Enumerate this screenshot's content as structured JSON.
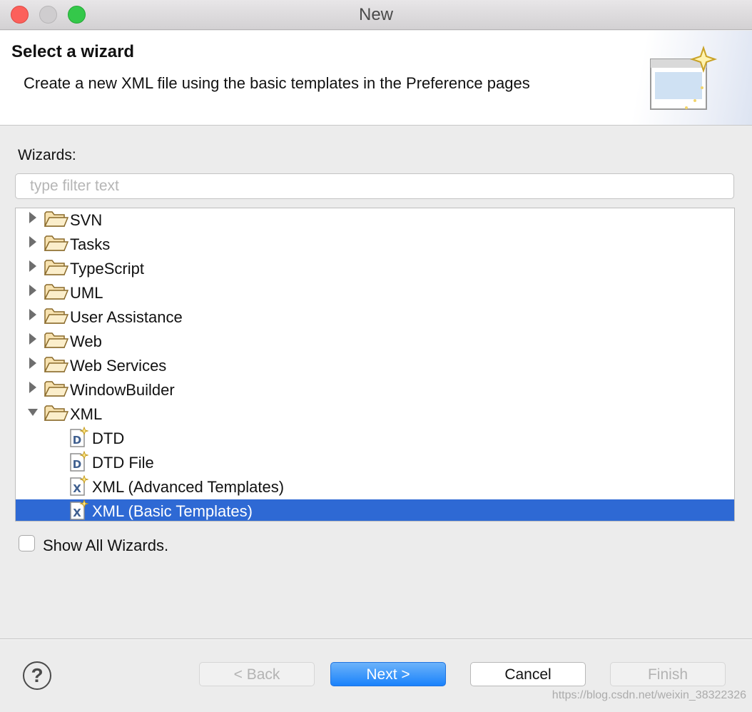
{
  "window": {
    "title": "New"
  },
  "banner": {
    "title": "Select a wizard",
    "description": "Create a new XML file using the basic templates in the Preference pages"
  },
  "wizards_label": "Wizards:",
  "filter": {
    "placeholder": "type filter text",
    "value": ""
  },
  "tree": {
    "items": [
      {
        "label": "SVN",
        "type": "folder",
        "expanded": false
      },
      {
        "label": "Tasks",
        "type": "folder",
        "expanded": false
      },
      {
        "label": "TypeScript",
        "type": "folder",
        "expanded": false
      },
      {
        "label": "UML",
        "type": "folder",
        "expanded": false
      },
      {
        "label": "User Assistance",
        "type": "folder",
        "expanded": false
      },
      {
        "label": "Web",
        "type": "folder",
        "expanded": false
      },
      {
        "label": "Web Services",
        "type": "folder",
        "expanded": false
      },
      {
        "label": "WindowBuilder",
        "type": "folder",
        "expanded": false
      },
      {
        "label": "XML",
        "type": "folder",
        "expanded": true
      },
      {
        "label": "DTD",
        "type": "file",
        "icon": "dtd-file-icon"
      },
      {
        "label": "DTD File",
        "type": "file",
        "icon": "dtd-file-icon"
      },
      {
        "label": "XML (Advanced Templates)",
        "type": "file",
        "icon": "xml-file-icon"
      },
      {
        "label": "XML (Basic Templates)",
        "type": "file",
        "icon": "xml-file-icon",
        "selected": true
      }
    ]
  },
  "show_all": {
    "label": "Show All Wizards.",
    "checked": false
  },
  "buttons": {
    "help": "?",
    "back": "< Back",
    "next": "Next >",
    "cancel": "Cancel",
    "finish": "Finish"
  },
  "watermark": "https://blog.csdn.net/weixin_38322326",
  "colors": {
    "selection": "#2e69d4",
    "primary_button": "#1a82fb",
    "close": "#fc605b",
    "maximize": "#34c84a"
  }
}
